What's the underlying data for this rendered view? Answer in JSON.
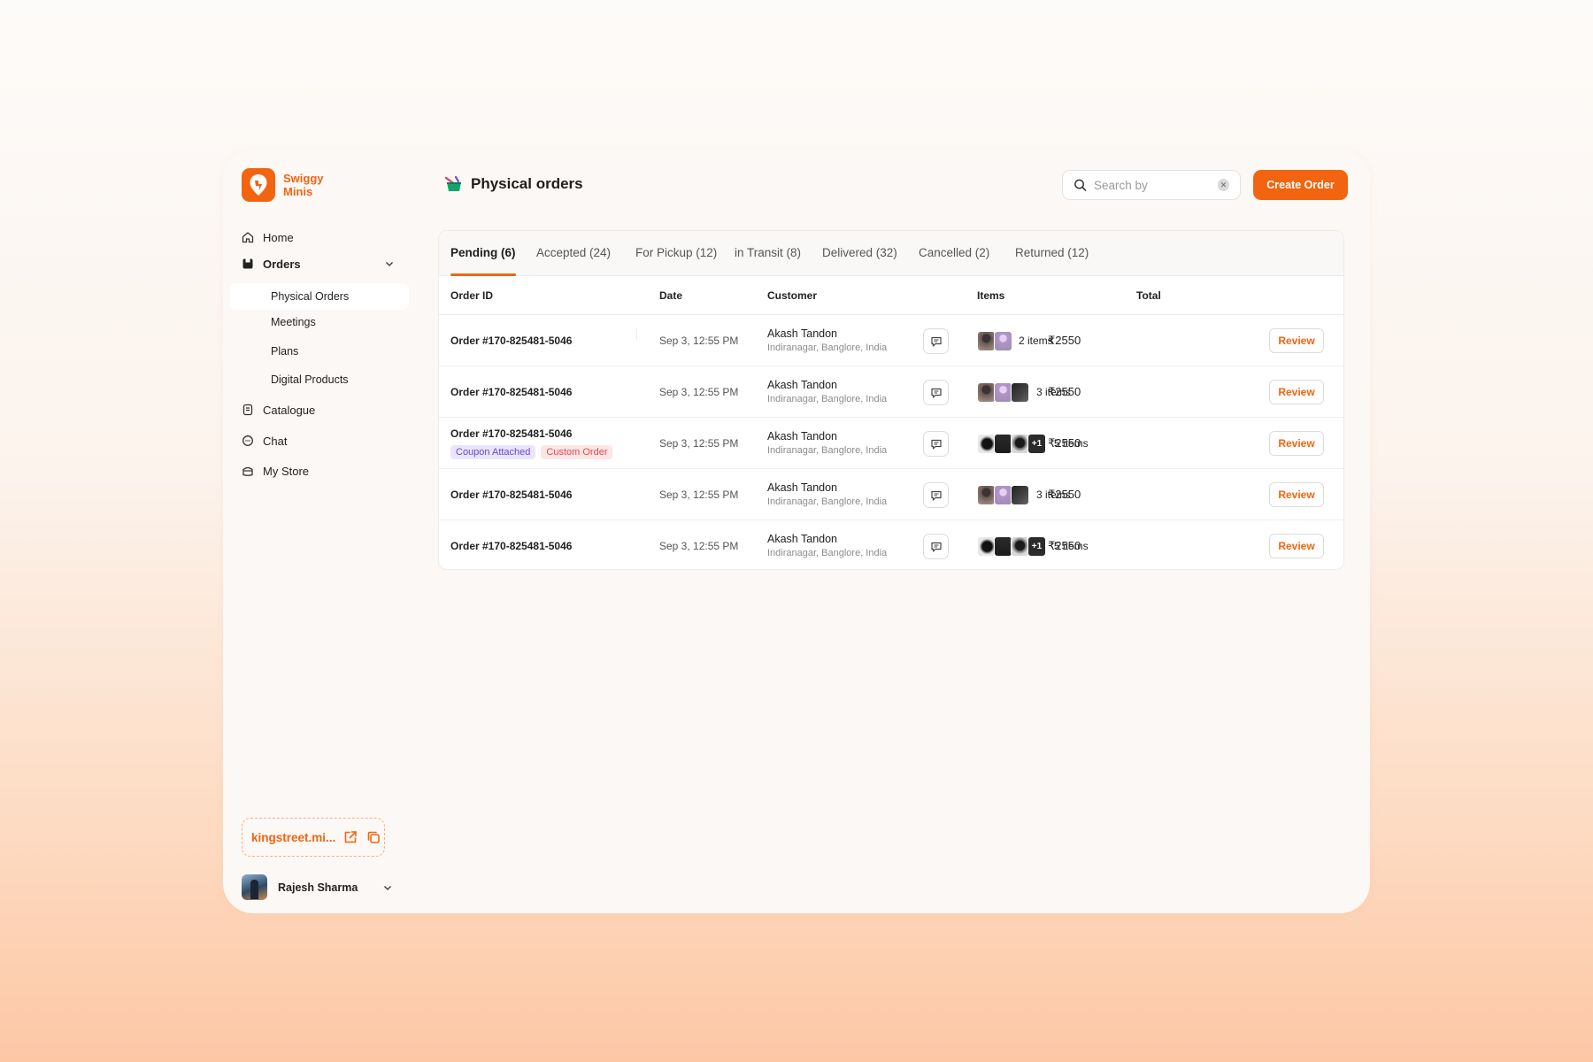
{
  "brand": {
    "name": "Swiggy Minis",
    "color": "#f2640f"
  },
  "sidebar": {
    "items": [
      {
        "id": "home",
        "label": "Home",
        "icon": "home-icon"
      },
      {
        "id": "orders",
        "label": "Orders",
        "icon": "orders-icon"
      },
      {
        "id": "catalogue",
        "label": "Catalogue",
        "icon": "catalogue-icon"
      },
      {
        "id": "chat",
        "label": "Chat",
        "icon": "chat-icon"
      },
      {
        "id": "mystore",
        "label": "My Store",
        "icon": "store-icon"
      }
    ],
    "orders_sub": [
      "Physical Orders",
      "Meetings",
      "Plans",
      "Digital Products"
    ],
    "active_sub": "Physical Orders",
    "store_url": "kingstreet.mi...",
    "user_name": "Rajesh Sharma"
  },
  "header": {
    "title": "Physical orders",
    "title_icon": "basket-icon",
    "search_placeholder": "Search by",
    "create_label": "Create Order"
  },
  "tabs": [
    "Pending (6)",
    "Accepted (24)",
    "For Pickup (12)",
    "in Transit (8)",
    "Delivered (32)",
    "Cancelled (2)",
    "Returned (12)"
  ],
  "active_tab": "Pending (6)",
  "table": {
    "columns": [
      "Order ID",
      "Date",
      "Customer",
      "Items",
      "Total"
    ],
    "rows": [
      {
        "order_id": "Order #170-825481-5046",
        "date": "Sep 3, 12:55 PM",
        "customer": "Akash Tandon",
        "location": "Indiranagar, Banglore, India",
        "items": "2 items",
        "total": "₹2550",
        "action": "Review",
        "tags": []
      },
      {
        "order_id": "Order #170-825481-5046",
        "date": "Sep 3, 12:55 PM",
        "customer": "Akash Tandon",
        "location": "Indiranagar, Banglore, India",
        "items": "3 items",
        "total": "₹2550",
        "action": "Review",
        "tags": []
      },
      {
        "order_id": "Order #170-825481-5046",
        "date": "Sep 3, 12:55 PM",
        "customer": "Akash Tandon",
        "location": "Indiranagar, Banglore, India",
        "items": "5 items",
        "total": "₹2550",
        "action": "Review",
        "tags": [
          "Coupon Attached",
          "Custom Order"
        ],
        "more_label": "+1"
      },
      {
        "order_id": "Order #170-825481-5046",
        "date": "Sep 3, 12:55 PM",
        "customer": "Akash Tandon",
        "location": "Indiranagar, Banglore, India",
        "items": "3 items",
        "total": "₹2550",
        "action": "Review",
        "tags": []
      },
      {
        "order_id": "Order #170-825481-5046",
        "date": "Sep 3, 12:55 PM",
        "customer": "Akash Tandon",
        "location": "Indiranagar, Banglore, India",
        "items": "5 items",
        "total": "₹2550",
        "action": "Review",
        "tags": [],
        "more_label": "+1"
      }
    ]
  }
}
